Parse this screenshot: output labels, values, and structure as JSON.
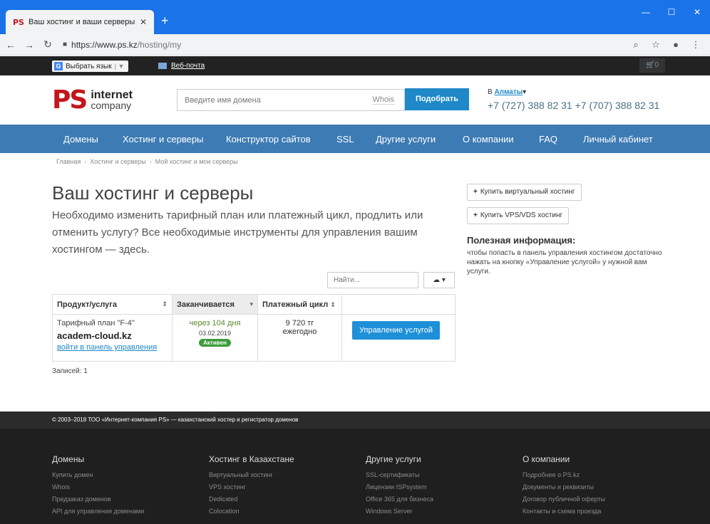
{
  "browser": {
    "tab_favicon": "PS",
    "tab_title": "Ваш хостинг и ваши серверы",
    "url_host": "https://www.ps.kz",
    "url_path": "/hosting/my"
  },
  "topbar": {
    "language_button": "Выбрать язык",
    "webmail": "Веб-почта",
    "cart_count": "0"
  },
  "header": {
    "logo_mark": "PS",
    "logo_line1": "internet",
    "logo_line2": "company",
    "search_placeholder": "Введите имя домена",
    "whois": "Whois",
    "pick_button": "Подобрать",
    "city_prefix": "В",
    "city": "Алматы",
    "phones": "+7 (727) 388 82 31 +7 (707) 388 82 31"
  },
  "nav": {
    "items": [
      "Домены",
      "Хостинг и серверы",
      "Конструктор сайтов",
      "SSL",
      "Другие услуги",
      "О компании",
      "FAQ",
      "Личный кабинет"
    ]
  },
  "breadcrumb": [
    "Главная",
    "Хостинг и серверы",
    "Мой хостинг и мои серверы"
  ],
  "main": {
    "title": "Ваш хостинг и серверы",
    "lead": "Необходимо изменить тарифный план или платежный цикл, продлить или отменить услугу? Все необходимые инструменты для управления вашим хостингом — здесь.",
    "search_placeholder": "Найти...",
    "table": {
      "headers": [
        "Продукт/услуга",
        "Заканчивается",
        "Платежный цикл",
        ""
      ],
      "rows": [
        {
          "plan": "Тарифный план \"F-4\"",
          "domain": "academ-cloud.kz",
          "panel_link": "войти в панель управления",
          "expires_in": "через 104 дня",
          "expires_date": "03.02.2019",
          "status": "Активен",
          "price": "9 720 тг",
          "cycle": "ежегодно",
          "action": "Управление услугой"
        }
      ]
    },
    "records": "Записей: 1"
  },
  "sidebar": {
    "buy_virtual": "Купить виртуальный хостинг",
    "buy_vps": "Купить VPS/VDS хостинг",
    "info_title": "Полезная информация:",
    "info_text": "чтобы попасть в панель управления хостингом достаточно нажать на кнопку «Управление услугой» у нужной вам услуги."
  },
  "footer": {
    "copyright": "© 2003–2018 ТОО «Интернет-компания PS» — казахстанский хостер и регистратор доменов",
    "columns": [
      {
        "title": "Домены",
        "links": [
          "Купить домен",
          "Whois",
          "Предзаказ доменов",
          "API для управления доменами"
        ]
      },
      {
        "title": "Хостинг в Казахстане",
        "links": [
          "Виртуальный хостинг",
          "VPS хостинг",
          "Dedicated",
          "Colocation"
        ]
      },
      {
        "title": "Другие услуги",
        "links": [
          "SSL-сертификаты",
          "Лицензии ISPsystem",
          "Office 365 для бизнеса",
          "Windows Server"
        ]
      },
      {
        "title": "О компании",
        "links": [
          "Подробнее о PS.kz",
          "Документы и реквизиты",
          "Договор публичной оферты",
          "Контакты и схема проезда"
        ]
      }
    ]
  },
  "colors": {
    "brand_red": "#c4161c",
    "nav_blue": "#3d7bb4",
    "accent_blue": "#1e88c8",
    "status_green": "#3c9b3c"
  }
}
